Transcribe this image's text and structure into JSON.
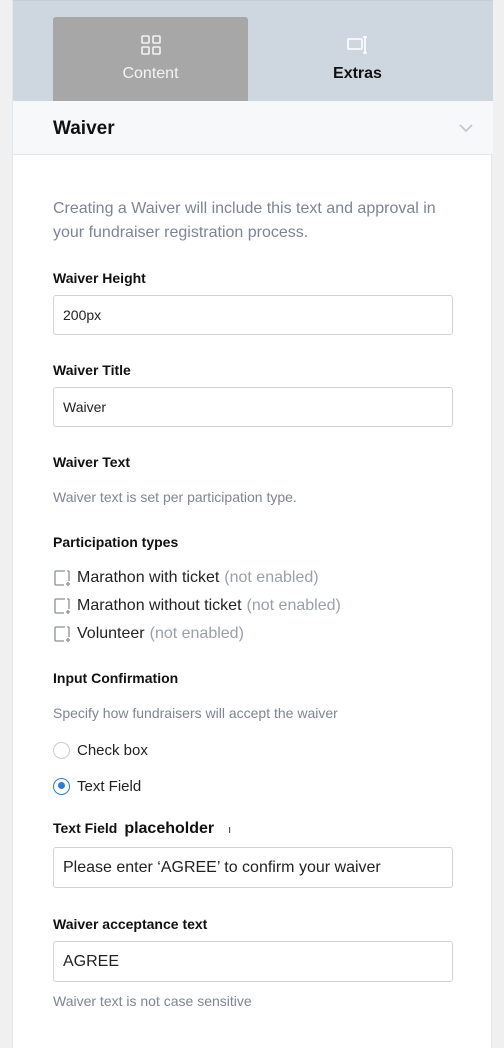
{
  "tabs": [
    {
      "label": "Content",
      "icon": "grid-icon",
      "active": true
    },
    {
      "label": "Extras",
      "icon": "extras-icon",
      "active": false
    }
  ],
  "section": {
    "title": "Waiver"
  },
  "intro": "Creating a Waiver will include this text and approval in your fundraiser registration process.",
  "waiver_height": {
    "label": "Waiver Height",
    "value": "200px"
  },
  "waiver_title": {
    "label": "Waiver Title",
    "value": "Waiver"
  },
  "waiver_text": {
    "label": "Waiver Text",
    "help": "Waiver text is set per participation type."
  },
  "participation": {
    "label": "Participation types",
    "items": [
      {
        "name": "Marathon with ticket",
        "status": "(not enabled)"
      },
      {
        "name": "Marathon without ticket",
        "status": "(not enabled)"
      },
      {
        "name": "Volunteer",
        "status": "(not enabled)"
      }
    ]
  },
  "input_confirmation": {
    "label": "Input Confirmation",
    "help": "Specify how fundraisers will accept the waiver",
    "options": [
      {
        "label": "Check box",
        "checked": false
      },
      {
        "label": "Text Field",
        "checked": true
      }
    ]
  },
  "text_field_placeholder": {
    "label_a": "Text Field",
    "label_b": "placeholder",
    "mark": "ı",
    "value": "Please enter ‘AGREE’ to confirm your waiver"
  },
  "acceptance": {
    "label": "Waiver acceptance text",
    "value": "AGREE",
    "help": "Waiver text is not case sensitive"
  },
  "colors": {
    "accent": "#2e7bd6",
    "tabs_bg": "#ced6e0",
    "active_tab": "#a7a7a7",
    "muted_text": "#7d8593"
  }
}
